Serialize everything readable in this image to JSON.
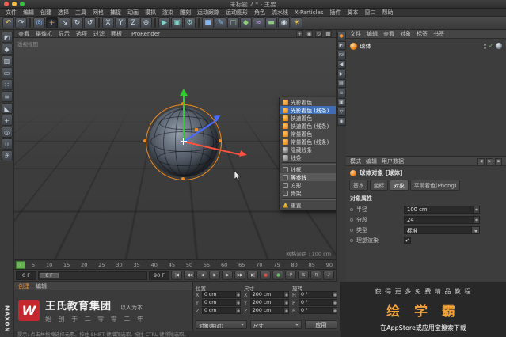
{
  "window": {
    "title": "未标题 2 * - 主要"
  },
  "menubar": {
    "items": [
      "文件",
      "编辑",
      "创建",
      "选择",
      "工具",
      "网格",
      "捕捉",
      "动画",
      "模拟",
      "渲染",
      "雕刻",
      "运动跟踪",
      "运动图形",
      "角色",
      "流水线",
      "X-Particles",
      "插件",
      "脚本",
      "窗口",
      "帮助"
    ]
  },
  "toolbar": {
    "icons": [
      {
        "name": "undo-icon",
        "glyph": "↶",
        "cls": "ic-y"
      },
      {
        "name": "redo-icon",
        "glyph": "↷"
      },
      {
        "name": "toolbar-separator",
        "cls": "tbsep"
      },
      {
        "name": "live-selection-icon",
        "glyph": "◎",
        "cls": "ic-b"
      },
      {
        "name": "move-tool-icon",
        "glyph": "+",
        "cls": "ic-o pressed"
      },
      {
        "name": "scale-tool-icon",
        "glyph": "↘"
      },
      {
        "name": "rotate-tool-icon",
        "glyph": "↻"
      },
      {
        "name": "last-tool-icon",
        "glyph": "↺"
      },
      {
        "name": "toolbar-separator",
        "cls": "tbsep"
      },
      {
        "name": "lock-x-axis-icon",
        "glyph": "X"
      },
      {
        "name": "lock-y-axis-icon",
        "glyph": "Y"
      },
      {
        "name": "lock-z-axis-icon",
        "glyph": "Z"
      },
      {
        "name": "coordinate-system-icon",
        "glyph": "⊕"
      },
      {
        "name": "toolbar-separator",
        "cls": "tbsep"
      },
      {
        "name": "render-view-icon",
        "glyph": "▶",
        "cls": "ic-teal"
      },
      {
        "name": "render-picture-viewer-icon",
        "glyph": "▣",
        "cls": "ic-teal"
      },
      {
        "name": "render-settings-icon",
        "glyph": "⚙",
        "cls": "ic-teal"
      },
      {
        "name": "toolbar-separator",
        "cls": "tbsep"
      },
      {
        "name": "add-cube-icon",
        "glyph": "■",
        "cls": "ic-b"
      },
      {
        "name": "add-spline-pen-icon",
        "glyph": "✎",
        "cls": "ic-b"
      },
      {
        "name": "add-subdivision-surface-icon",
        "glyph": "▢",
        "cls": "ic-g"
      },
      {
        "name": "add-generator-icon",
        "glyph": "◆",
        "cls": "ic-g"
      },
      {
        "name": "add-deformer-icon",
        "glyph": "≈",
        "cls": "ic-p"
      },
      {
        "name": "add-environment-icon",
        "glyph": "▬",
        "cls": "ic-g"
      },
      {
        "name": "add-camera-icon",
        "glyph": "◉"
      },
      {
        "name": "add-light-icon",
        "glyph": "☀",
        "cls": "ic-y"
      }
    ]
  },
  "left_toolbar": {
    "icons": [
      {
        "name": "make-editable-icon",
        "glyph": "◩"
      },
      {
        "name": "model-mode-icon",
        "glyph": "◆"
      },
      {
        "name": "texture-mode-icon",
        "glyph": "▨"
      },
      {
        "name": "workplane-mode-icon",
        "glyph": "▭"
      },
      {
        "name": "points-mode-icon",
        "glyph": "∷"
      },
      {
        "name": "edges-mode-icon",
        "glyph": "≡"
      },
      {
        "name": "polygons-mode-icon",
        "glyph": "◣"
      },
      {
        "name": "enable-axis-icon",
        "glyph": "+"
      },
      {
        "name": "viewport-solo-icon",
        "glyph": "◎"
      },
      {
        "name": "enable-snap-icon",
        "glyph": "∪"
      },
      {
        "name": "workplane-snap-icon",
        "glyph": "#"
      }
    ]
  },
  "side_strip": {
    "icons": [
      {
        "name": "material-preview-icon",
        "glyph": "●",
        "cls": "ic-o"
      },
      {
        "name": "make-editable-shortcut-icon",
        "glyph": "◩"
      },
      {
        "name": "reset-psr-icon",
        "glyph": "PSR",
        "cls": "ss-psr"
      },
      {
        "name": "prev-object-icon",
        "glyph": "◀"
      },
      {
        "name": "next-object-icon",
        "glyph": "▶"
      },
      {
        "name": "scroll-to-object-icon",
        "glyph": "▤"
      },
      {
        "name": "layer-manager-icon",
        "glyph": "≡"
      },
      {
        "name": "lock-panel-icon",
        "glyph": "▣"
      },
      {
        "name": "filter-icon",
        "glyph": "▽"
      },
      {
        "name": "search-icon",
        "glyph": "◉"
      }
    ]
  },
  "viewport": {
    "menu_items": [
      "查看",
      "摄像机",
      "显示",
      "选项",
      "过滤",
      "面板"
    ],
    "prorender_label": "ProRender",
    "view_icons": [
      {
        "name": "pan-view-icon",
        "glyph": "+"
      },
      {
        "name": "zoom-view-icon",
        "glyph": "◉"
      },
      {
        "name": "rotate-view-icon",
        "glyph": "↻"
      },
      {
        "name": "toggle-panel-icon",
        "glyph": "▦"
      }
    ],
    "view_label": "透视视图",
    "object_name": "球体",
    "grid_spacing": "网格间距 : 100 cm"
  },
  "display_menu": {
    "items": [
      {
        "label": "光影着色",
        "cls": "ic-orange"
      },
      {
        "label": "光影着色 (线条)",
        "cls": "ic-orange hover"
      },
      {
        "label": "快速着色",
        "cls": "ic-orange"
      },
      {
        "label": "快速着色 (线条)",
        "cls": "ic-orange"
      },
      {
        "label": "常量着色",
        "cls": "ic-orange"
      },
      {
        "label": "常量着色 (线条)",
        "cls": "ic-orange"
      },
      {
        "label": "隐藏线条",
        "cls": "ic-gray"
      },
      {
        "label": "线条",
        "cls": "ic-gray"
      },
      {
        "cls": "dm-sep"
      },
      {
        "label": "线框",
        "cls": "ic-wire"
      },
      {
        "label": "等参线",
        "cls": "ic-wire checked"
      },
      {
        "label": "方形",
        "cls": "ic-wire"
      },
      {
        "label": "骨架",
        "cls": "ic-wire"
      },
      {
        "cls": "dm-sep"
      },
      {
        "label": "重置",
        "cls": "ic-warn"
      }
    ]
  },
  "timeline": {
    "ticks": [
      "0",
      "5",
      "10",
      "15",
      "20",
      "25",
      "30",
      "35",
      "40",
      "45",
      "50",
      "55",
      "60",
      "65",
      "70",
      "75",
      "80",
      "85",
      "90"
    ],
    "start_field": "0 F",
    "slider_label": "0 F",
    "end_field": "90 F",
    "buttons": [
      {
        "name": "goto-start-button",
        "glyph": "|◀"
      },
      {
        "name": "prev-key-button",
        "glyph": "◀◀"
      },
      {
        "name": "prev-frame-button",
        "glyph": "◀"
      },
      {
        "name": "play-button",
        "glyph": "▶"
      },
      {
        "name": "next-frame-button",
        "glyph": "▶"
      },
      {
        "name": "next-key-button",
        "glyph": "▶▶"
      },
      {
        "name": "goto-end-button",
        "glyph": "▶|"
      },
      {
        "name": "record-keyframe-button",
        "glyph": "●",
        "cls": "rec-red"
      },
      {
        "name": "autokey-button",
        "glyph": "●",
        "cls": "rec-green"
      },
      {
        "name": "record-position-button",
        "glyph": "P"
      },
      {
        "name": "record-scale-button",
        "glyph": "S"
      },
      {
        "name": "record-rotation-button",
        "glyph": "R"
      },
      {
        "name": "play-sound-button",
        "glyph": "♪"
      }
    ]
  },
  "object_manager": {
    "menu": [
      "文件",
      "编辑",
      "查看",
      "对象",
      "标签",
      "书签"
    ],
    "object_label": "球体",
    "check_glyph": "✓"
  },
  "attributes": {
    "menu": [
      "模式",
      "编辑",
      "用户数据"
    ],
    "nav": {
      "prev": "◀",
      "next": "▶",
      "lock": "▪"
    },
    "title": "球体对象 [球体]",
    "tabs": [
      {
        "label": "基本"
      },
      {
        "label": "坐标"
      },
      {
        "label": "对象",
        "cls": "active"
      },
      {
        "label": "平滑着色(Phong)"
      }
    ],
    "section": "对象属性",
    "props": [
      {
        "label": "半径",
        "value": "100 cm"
      },
      {
        "label": "分段",
        "value": "24"
      },
      {
        "label": "类型",
        "value": "标准"
      },
      {
        "label": "理想渲染",
        "value": "✓"
      }
    ]
  },
  "materials_panel": {
    "menu": [
      {
        "label": "创建",
        "cls": "hl"
      },
      {
        "label": "编辑"
      }
    ]
  },
  "coordinates": {
    "columns": [
      {
        "title": "位置",
        "rows": [
          {
            "axis": "X",
            "value": "0 cm"
          },
          {
            "axis": "Y",
            "value": "0 cm"
          },
          {
            "axis": "Z",
            "value": "0 cm"
          }
        ]
      },
      {
        "title": "尺寸",
        "rows": [
          {
            "axis": "X",
            "value": "200 cm"
          },
          {
            "axis": "Y",
            "value": "200 cm"
          },
          {
            "axis": "Z",
            "value": "200 cm"
          }
        ]
      },
      {
        "title": "旋转",
        "rows": [
          {
            "axis": "H",
            "value": "0 °"
          },
          {
            "axis": "P",
            "value": "0 °"
          },
          {
            "axis": "B",
            "value": "0 °"
          }
        ]
      }
    ],
    "mode_select": "对象(相对)",
    "size_select": "尺寸",
    "apply_label": "应用"
  },
  "ads": {
    "left": {
      "logo_text": "W",
      "title": "王氏教育集团",
      "tagline": "以人为本",
      "subtitle": "始 创 于 二 零 零 二 年"
    },
    "right": {
      "line1": "获 得 更 多 免 费 精 品 教 程",
      "app_name": "绘 学 霸",
      "line3": "在AppStore或应用宝搜索下载"
    }
  },
  "branding": {
    "vertical_text": "MAXON"
  },
  "statusbar": {
    "text": "提示: 点击并拖拽选择元素。按住 SHIFT 键增加选取, 按住 CTRL 键移除选取。"
  },
  "colors": {
    "accent_orange": "#e8821e",
    "highlight_blue": "#3e6db5",
    "axis_x": "#ff5040",
    "axis_y": "#2ecc2e",
    "axis_z": "#4a6bff",
    "ad_red": "#c4272e",
    "ad_orange": "#f2a33c",
    "autokey_green": "#6bc26b"
  }
}
